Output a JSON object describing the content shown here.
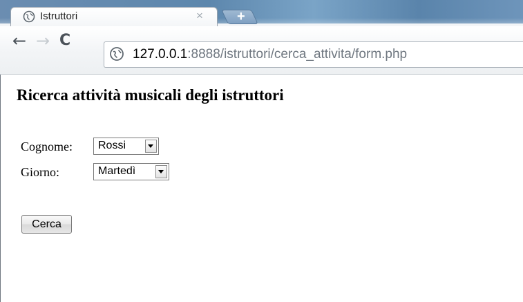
{
  "browser": {
    "tab": {
      "title": "Istruttori",
      "favicon": "globe-icon",
      "close_glyph": "×"
    },
    "new_tab_glyph": "+",
    "nav": {
      "back_icon": "back-arrow-icon",
      "forward_icon": "forward-arrow-icon",
      "reload_icon": "reload-icon"
    },
    "address": {
      "host": "127.0.0.1",
      "rest": ":8888/istruttori/cerca_attivita/form.php"
    }
  },
  "page": {
    "title": "Ricerca attività musicali degli istruttori",
    "form": {
      "cognome_label": "Cognome:",
      "cognome_value": "Rossi",
      "giorno_label": "Giorno:",
      "giorno_value": "Martedì",
      "submit_label": "Cerca"
    }
  },
  "colors": {
    "chrome_blue": "#5d87ad",
    "url_host": "#000000",
    "url_rest": "#6f7780"
  }
}
